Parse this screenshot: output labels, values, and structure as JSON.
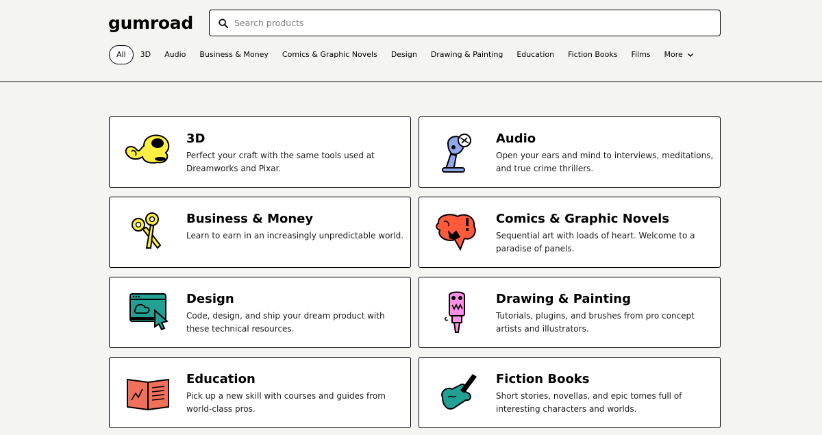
{
  "header": {
    "logo": "gumroad",
    "search": {
      "placeholder": "Search products",
      "value": ""
    }
  },
  "nav": {
    "items": [
      {
        "label": "All",
        "active": true
      },
      {
        "label": "3D"
      },
      {
        "label": "Audio"
      },
      {
        "label": "Business & Money"
      },
      {
        "label": "Comics & Graphic Novels"
      },
      {
        "label": "Design"
      },
      {
        "label": "Drawing & Painting"
      },
      {
        "label": "Education"
      },
      {
        "label": "Fiction Books"
      },
      {
        "label": "Films"
      }
    ],
    "more_label": "More"
  },
  "categories": [
    {
      "title": "3D",
      "description": "Perfect your craft with the same tools used at Dreamworks and Pixar.",
      "icon": "3d-blob-icon",
      "color": "#ffee44"
    },
    {
      "title": "Audio",
      "description": "Open your ears and mind to interviews, meditations, and true crime thrillers.",
      "icon": "microphone-icon",
      "color": "#90a8ed"
    },
    {
      "title": "Business & Money",
      "description": "Learn to earn in an increasingly unpredictable world.",
      "icon": "scissors-icon",
      "color": "#ffee44"
    },
    {
      "title": "Comics & Graphic Novels",
      "description": "Sequential art with loads of heart. Welcome to a paradise of panels.",
      "icon": "speech-burst-icon",
      "color": "#ff5a3c"
    },
    {
      "title": "Design",
      "description": "Code, design, and ship your dream product with these technical resources.",
      "icon": "browser-window-icon",
      "color": "#23a094"
    },
    {
      "title": "Drawing & Painting",
      "description": "Tutorials, plugins, and brushes from pro concept artists and illustrators.",
      "icon": "paintbrush-icon",
      "color": "#ff90e8"
    },
    {
      "title": "Education",
      "description": "Pick up a new skill with courses and guides from world-class pros.",
      "icon": "open-book-icon",
      "color": "#f1705a"
    },
    {
      "title": "Fiction Books",
      "description": "Short stories, novellas, and epic tomes full of interesting characters and worlds.",
      "icon": "hand-writing-icon",
      "color": "#23a094"
    }
  ]
}
